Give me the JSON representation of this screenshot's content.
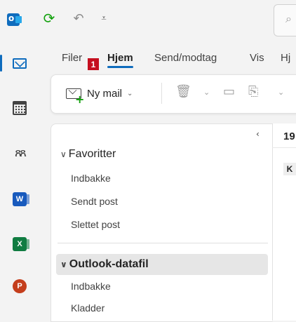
{
  "quick_access": {
    "icons": [
      "outlook-logo",
      "sync-icon",
      "undo-icon",
      "customize-quick-access-icon"
    ]
  },
  "rail": {
    "items": [
      "mail",
      "calendar",
      "people",
      "word",
      "excel",
      "powerpoint"
    ],
    "word_letter": "W",
    "excel_letter": "X",
    "powerpoint_letter": "P"
  },
  "tabs": [
    {
      "label": "Filer"
    },
    {
      "label": "Hjem"
    },
    {
      "label": "Send/modtag"
    },
    {
      "label": "Vis"
    },
    {
      "label": "Hj"
    }
  ],
  "badge": "1",
  "ribbon": {
    "new_mail_label": "Ny mail"
  },
  "folder_pane": {
    "favorites_label": "Favoritter",
    "favorites": [
      "Indbakke",
      "Sendt post",
      "Slettet post"
    ],
    "datafile_label": "Outlook-datafil",
    "datafile_folders": [
      "Indbakke",
      "Kladder"
    ]
  },
  "message_list": {
    "date_stub": "19",
    "avatar_letter": "K"
  },
  "colors": {
    "accent": "#0f6cbd",
    "badge": "#c50f1f",
    "sync": "#13a10e"
  }
}
